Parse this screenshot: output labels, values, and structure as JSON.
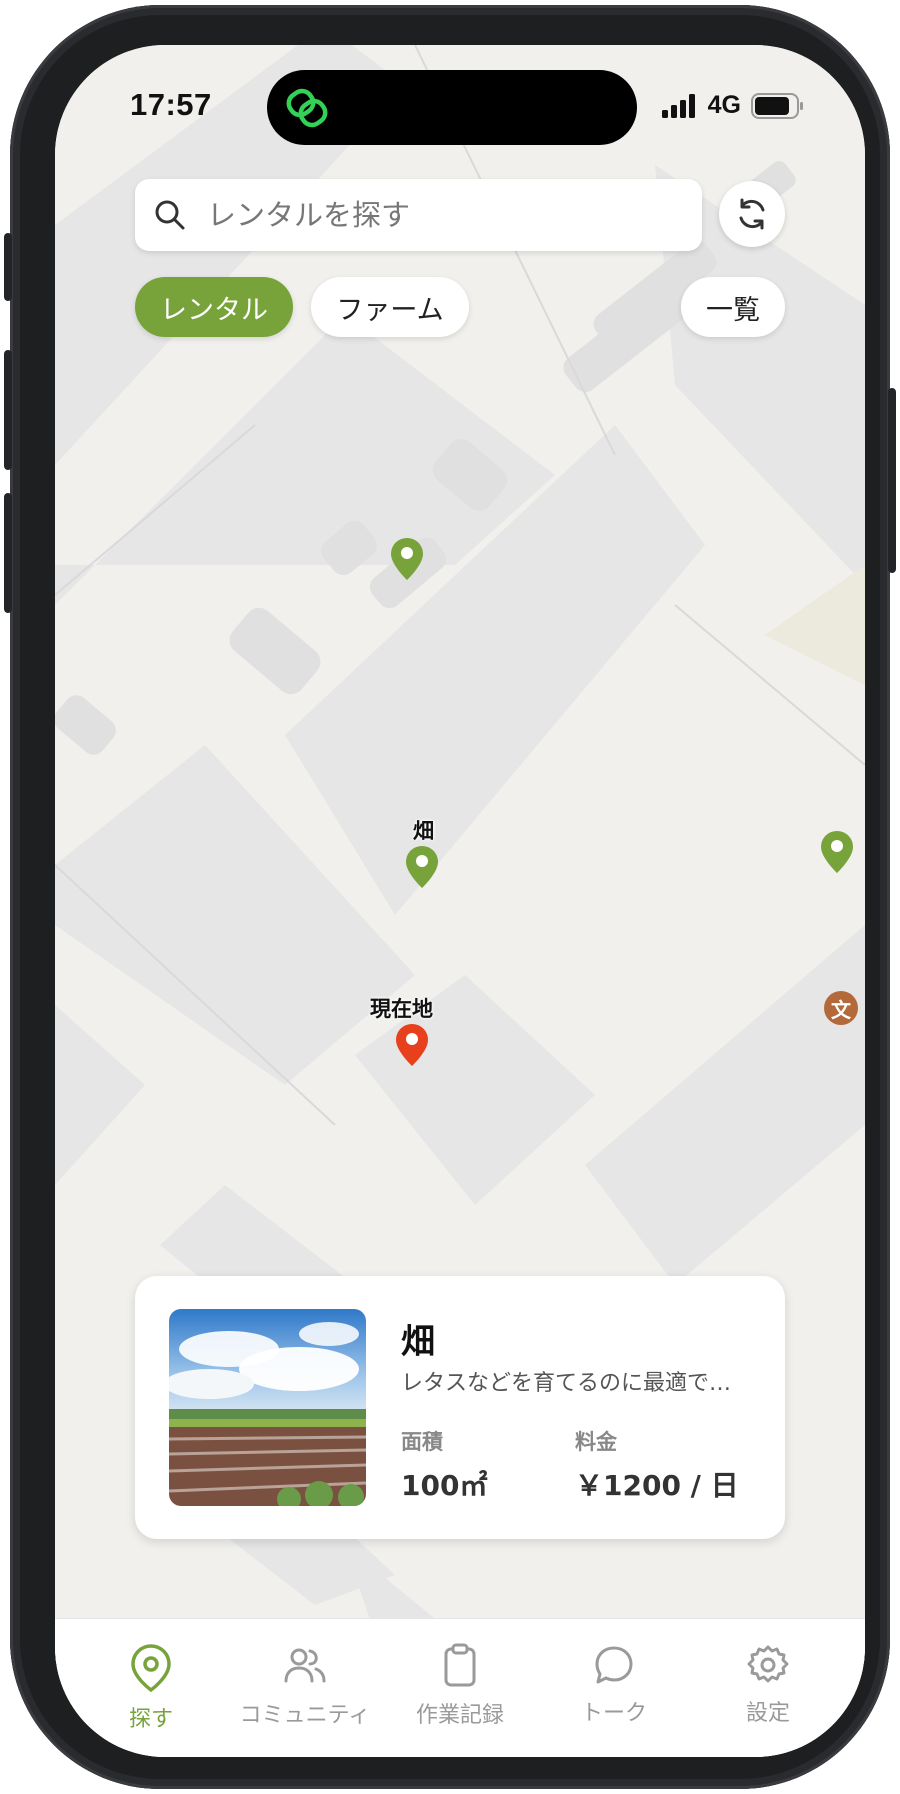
{
  "status_bar": {
    "time": "17:57",
    "network": "4G"
  },
  "search": {
    "placeholder": "レンタルを探す"
  },
  "filters": {
    "rental": "レンタル",
    "farm": "ファーム",
    "list": "一覧"
  },
  "map": {
    "markers": [
      {
        "label": "",
        "color": "#77a33a"
      },
      {
        "label": "畑",
        "color": "#77a33a"
      },
      {
        "label": "",
        "color": "#77a33a"
      },
      {
        "label": "現在地",
        "color": "#e8401c"
      }
    ],
    "poi_badge": "文"
  },
  "card": {
    "title": "畑",
    "description": "レタスなどを育てるのに最適で…",
    "area_label": "面積",
    "area_value": "100㎡",
    "price_label": "料金",
    "price_value": "￥1200 / 日"
  },
  "tabs": [
    {
      "label": "探す",
      "icon": "map-pin-icon",
      "active": true
    },
    {
      "label": "コミュニティ",
      "icon": "users-icon"
    },
    {
      "label": "作業記録",
      "icon": "clipboard-icon"
    },
    {
      "label": "トーク",
      "icon": "chat-bubble-icon"
    },
    {
      "label": "設定",
      "icon": "gear-icon"
    }
  ],
  "colors": {
    "accent": "#77a33a",
    "current_location": "#e8401c",
    "map_bg": "#f1f0ec",
    "block": "#e6e6e6"
  }
}
